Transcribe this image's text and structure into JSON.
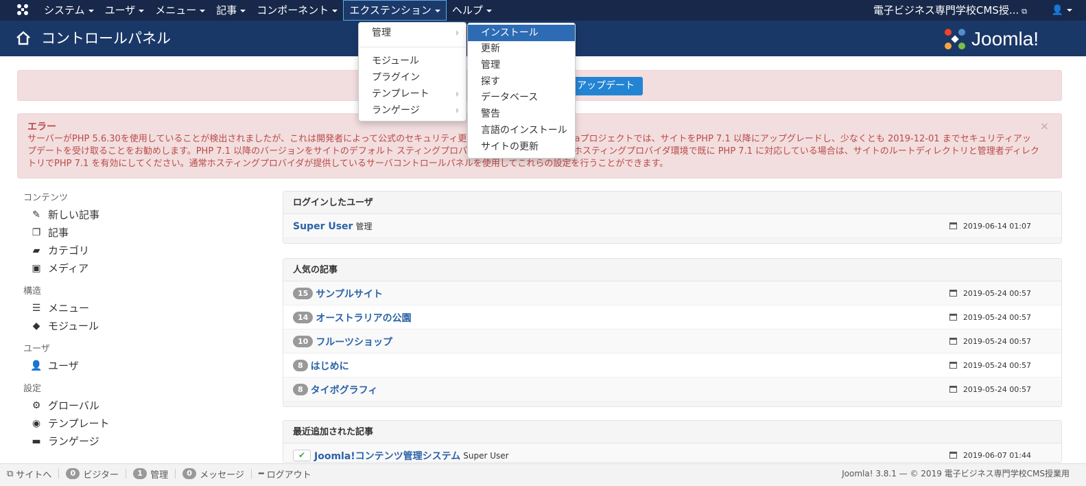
{
  "navbar": {
    "menu": [
      {
        "label": "システム",
        "name": "nav-system"
      },
      {
        "label": "ユーザ",
        "name": "nav-users"
      },
      {
        "label": "メニュー",
        "name": "nav-menus"
      },
      {
        "label": "記事",
        "name": "nav-content"
      },
      {
        "label": "コンポーネント",
        "name": "nav-components"
      },
      {
        "label": "エクステンション",
        "name": "nav-extensions"
      },
      {
        "label": "ヘルプ",
        "name": "nav-help"
      }
    ],
    "site_name": "電子ビジネス専門学校CMS授..."
  },
  "header": {
    "title": "コントロールパネル",
    "brand": "Joomla!"
  },
  "alerts": {
    "update_button": "アップデート",
    "error_heading": "エラー",
    "error_body": "サーバーがPHP 5.6.30を使用していることが検出されましたが、これは開発者によって公式のセキュリティ更新 なくなりました。Joomlaプロジェクトでは、サイトをPHP 7.1 以降にアップグレードし、少なくとも 2019-12-01 までセキュリティアップデートを受け取ることをお勧めします。PHP 7.1 以降のバージョンをサイトのデフォルト スティングプロバイダに依頼してください。ホスティングプロバイダ環境で既に PHP 7.1 に対応している場合は、サイトのルートディレクトリと管理者ディレクトリでPHP 7.1 を有効にしてください。通常ホスティングプロバイダが提供しているサーバコントロールパネルを使用してこれらの設定を行うことができます。",
    "close": "×"
  },
  "sidebar": {
    "content_head": "コンテンツ",
    "content_items": [
      "新しい記事",
      "記事",
      "カテゴリ",
      "メディア"
    ],
    "structure_head": "構造",
    "structure_items": [
      "メニュー",
      "モジュール"
    ],
    "users_head": "ユーザ",
    "users_items": [
      "ユーザ"
    ],
    "config_head": "設定",
    "config_items": [
      "グローバル",
      "テンプレート",
      "ランゲージ"
    ]
  },
  "modules": {
    "logged": {
      "title": "ログインしたユーザ",
      "user": "Super User",
      "role": "管理",
      "date": "2019-06-14 01:07"
    },
    "popular": {
      "title": "人気の記事",
      "rows": [
        {
          "hits": "15",
          "title": "サンプルサイト",
          "date": "2019-05-24 00:57"
        },
        {
          "hits": "14",
          "title": "オーストラリアの公園",
          "date": "2019-05-24 00:57"
        },
        {
          "hits": "10",
          "title": "フルーツショップ",
          "date": "2019-05-24 00:57"
        },
        {
          "hits": "8",
          "title": "はじめに",
          "date": "2019-05-24 00:57"
        },
        {
          "hits": "8",
          "title": "タイポグラフィ",
          "date": "2019-05-24 00:57"
        }
      ]
    },
    "recent": {
      "title": "最近追加された記事",
      "rows": [
        {
          "title": "Joomla!コンテンツ管理システム",
          "author": "Super User",
          "date": "2019-06-07 01:44"
        }
      ]
    }
  },
  "dropdown": {
    "main": [
      {
        "label": "管理",
        "submenu": true
      },
      {
        "label": "モジュール",
        "submenu": false
      },
      {
        "label": "プラグイン",
        "submenu": false
      },
      {
        "label": "テンプレート",
        "submenu": true
      },
      {
        "label": "ランゲージ",
        "submenu": true
      }
    ],
    "sub": [
      "インストール",
      "更新",
      "管理",
      "探す",
      "データベース",
      "警告",
      "言語のインストール",
      "サイトの更新"
    ]
  },
  "statusbar": {
    "view_site": "サイトへ",
    "visitors_count": "0",
    "visitors_label": "ビジター",
    "admins_count": "1",
    "admins_label": "管理",
    "messages_count": "0",
    "messages_label": "メッセージ",
    "logout": "ログアウト",
    "version": "Joomla! 3.8.1 — © 2019 電子ビジネス専門学校CMS授業用"
  },
  "colors": {
    "navbar": "#17284a",
    "header": "#1a3867",
    "alert_bg": "#f2dede",
    "alert_text": "#b94a48",
    "link": "#2a62a7",
    "highlight": "#2d6cb5"
  }
}
